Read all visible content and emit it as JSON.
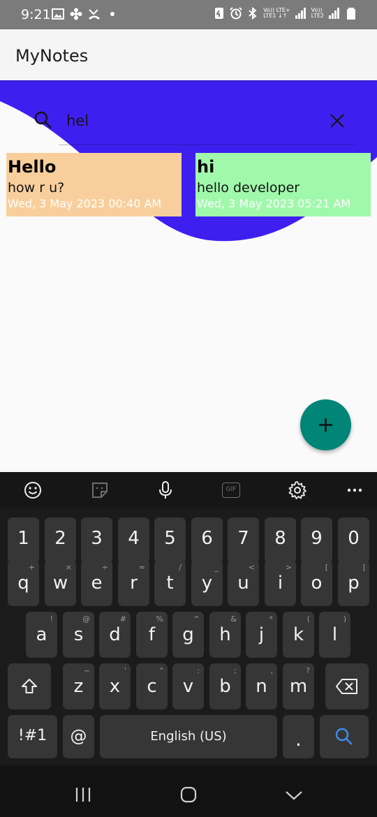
{
  "status_bar": {
    "time": "9:21",
    "net1": "Vo)) LTE+",
    "net1b": "LTE1 ↓↑",
    "net2": "Vo))",
    "net2b": "LTE2"
  },
  "app_bar": {
    "title": "MyNotes"
  },
  "search": {
    "value": "hel",
    "placeholder": ""
  },
  "notes": [
    {
      "title": "Hello",
      "body": "how r u?",
      "date": "Wed, 3 May 2023 00:40 AM",
      "color": "#f8cf9c"
    },
    {
      "title": "hi",
      "body": "hello developer",
      "date": "Wed, 3 May 2023 05:21 AM",
      "color": "#a0f9ab"
    }
  ],
  "colors": {
    "accent_purple": "#3f1ff0",
    "fab": "#008577",
    "keyboard_bg": "#1b1b1b"
  },
  "fab": {
    "icon": "plus-icon"
  },
  "keyboard": {
    "toolbar_icons": [
      "emoji-icon",
      "sticker-icon",
      "mic-icon",
      "gif-icon",
      "settings-icon",
      "more-icon"
    ],
    "gif_label": "GIF",
    "row_numbers": [
      "1",
      "2",
      "3",
      "4",
      "5",
      "6",
      "7",
      "8",
      "9",
      "0"
    ],
    "row1": {
      "keys": [
        "q",
        "w",
        "e",
        "r",
        "t",
        "y",
        "u",
        "i",
        "o",
        "p"
      ],
      "hints": [
        "+",
        "×",
        "÷",
        "=",
        "/",
        "_",
        "<",
        ">",
        "[",
        "]"
      ]
    },
    "row2": {
      "keys": [
        "a",
        "s",
        "d",
        "f",
        "g",
        "h",
        "j",
        "k",
        "l"
      ],
      "hints": [
        "!",
        "@",
        "#",
        "%",
        "^",
        "&",
        "*",
        "(",
        ")"
      ]
    },
    "row3": {
      "keys": [
        "z",
        "x",
        "c",
        "v",
        "b",
        "n",
        "m"
      ],
      "hints": [
        "~",
        "'",
        "\"",
        ":",
        ";",
        ",",
        "?"
      ]
    },
    "symbols_label": "!#1",
    "at_label": "@",
    "space_label": "English (US)",
    "period_label": ".",
    "search_key_icon": "search-icon"
  },
  "nav_bar": {
    "icons": [
      "recents-icon",
      "home-icon",
      "back-icon"
    ]
  }
}
